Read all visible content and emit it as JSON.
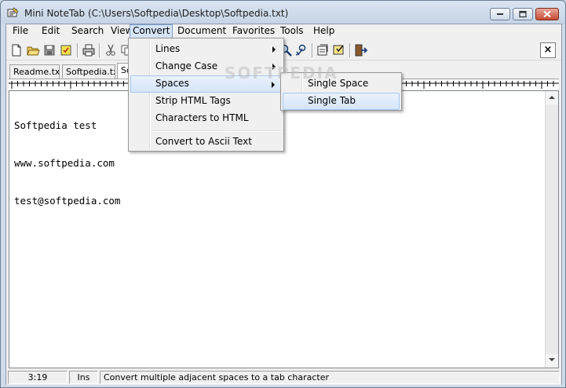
{
  "window": {
    "title": "Mini NoteTab (C:\\Users\\Softpedia\\Desktop\\Softpedia.txt)"
  },
  "menubar": {
    "items": [
      "File",
      "Edit",
      "Search",
      "View",
      "Convert",
      "Document",
      "Favorites",
      "Tools",
      "Help"
    ],
    "active": "Convert"
  },
  "toolbar": {
    "close_document_glyph": "×"
  },
  "tabs": [
    "Readme.txt",
    "Softpedia.txt",
    "So"
  ],
  "editor": {
    "lines": [
      "Softpedia test",
      "www.softpedia.com",
      "test@softpedia.com"
    ]
  },
  "convert_menu": {
    "items": [
      {
        "label": "Lines",
        "submenu": true
      },
      {
        "label": "Change Case",
        "submenu": true
      },
      {
        "label": "Spaces",
        "submenu": true,
        "highlighted": true
      },
      {
        "label": "Strip HTML Tags",
        "submenu": false
      },
      {
        "label": "Characters to HTML",
        "submenu": false
      },
      {
        "label": "Convert to Ascii Text",
        "submenu": false
      }
    ]
  },
  "spaces_submenu": {
    "items": [
      {
        "label": "Single Space",
        "highlighted": false
      },
      {
        "label": "Single Tab",
        "highlighted": true
      }
    ]
  },
  "statusbar": {
    "position": "3:19",
    "mode": "Ins",
    "message": "Convert multiple adjacent spaces to a tab character"
  },
  "watermark": "SOFTPEDIA",
  "colors": {
    "menu_highlight": "#d4e5f9",
    "close_button": "#c84a31"
  }
}
